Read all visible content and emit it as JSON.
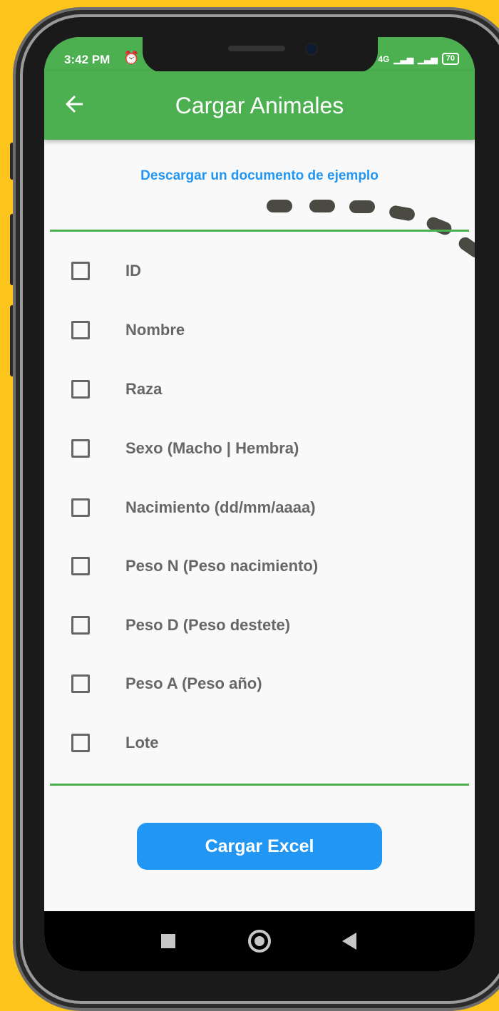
{
  "status_bar": {
    "time": "3:42 PM",
    "alarm_icon": "alarm-clock-icon",
    "network": "4G",
    "battery": "70"
  },
  "app_bar": {
    "back_icon": "arrow-left-icon",
    "title": "Cargar Animales"
  },
  "download_link": "Descargar un documento de ejemplo",
  "fields": [
    "ID",
    "Nombre",
    "Raza",
    "Sexo (Macho | Hembra)",
    "Nacimiento (dd/mm/aaaa)",
    "Peso N (Peso nacimiento)",
    "Peso D (Peso destete)",
    "Peso A (Peso año)",
    "Lote"
  ],
  "load_button": "Cargar Excel",
  "colors": {
    "primary": "#4CAF50",
    "accent": "#2196F3",
    "background": "#FDC51C"
  }
}
